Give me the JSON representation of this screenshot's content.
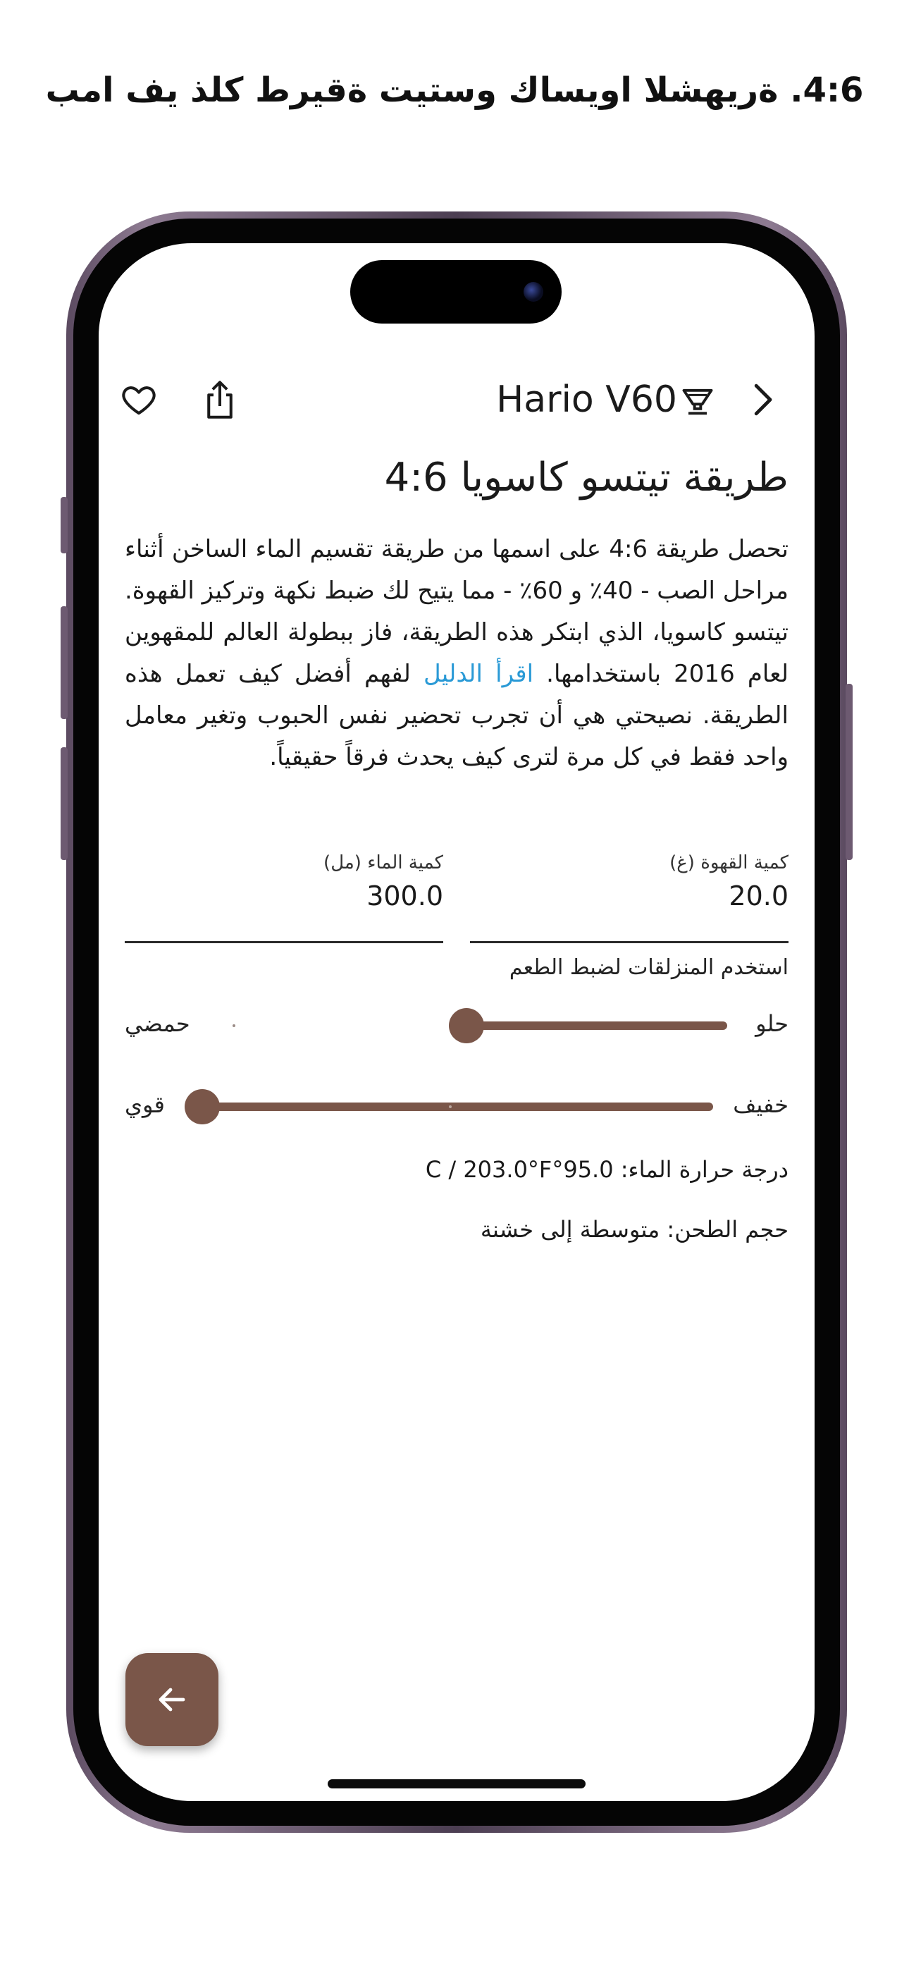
{
  "headline": "4:6. ةريهشلا اويساك وستيت ةقيرط كلذ يف امب",
  "topbar": {
    "title": "Hario V60",
    "favorite_icon": "heart-outline-icon",
    "share_icon": "share-icon",
    "brewer_icon": "v60-dripper-icon",
    "forward_icon": "chevron-right-icon"
  },
  "recipe": {
    "title": "طريقة تيتسو كاسويا 4:6",
    "desc_part1": "تحصل طريقة 4:6 على اسمها من طريقة تقسيم الماء الساخن أثناء مراحل الصب - 40٪ و 60٪ - مما يتيح لك ضبط نكهة وتركيز القهوة. تيتسو كاسويا، الذي ابتكر هذه الطريقة، فاز ببطولة العالم للمقهوين لعام 2016 باستخدامها.",
    "link": "اقرأ الدليل",
    "desc_part2": "لفهم أفضل كيف تعمل هذه الطريقة. نصيحتي هي أن تجرب تحضير نفس الحبوب وتغير معامل واحد فقط في كل مرة لترى كيف يحدث فرقاً حقيقياً."
  },
  "inputs": {
    "coffee_label": "كمية القهوة (غ)",
    "coffee_value": "20.0",
    "water_label": "كمية الماء (مل)",
    "water_value": "300.0"
  },
  "sliders": {
    "hint": "استخدم المنزلقات لضبط الطعم",
    "taste": {
      "right_label": "حلو",
      "left_label": "حمضي",
      "value_fraction": 1.0
    },
    "strength": {
      "right_label": "خفيف",
      "left_label": "قوي",
      "value_fraction": 1.0
    }
  },
  "info": {
    "temperature": "درجة حرارة الماء: 95.0°C / 203.0°F",
    "grind": "حجم الطحن: متوسطة إلى خشنة"
  },
  "fab": {
    "icon": "arrow-left-icon"
  },
  "colors": {
    "accent": "#7a5649",
    "link": "#2a9ad6",
    "frame": "#6d5a71"
  }
}
